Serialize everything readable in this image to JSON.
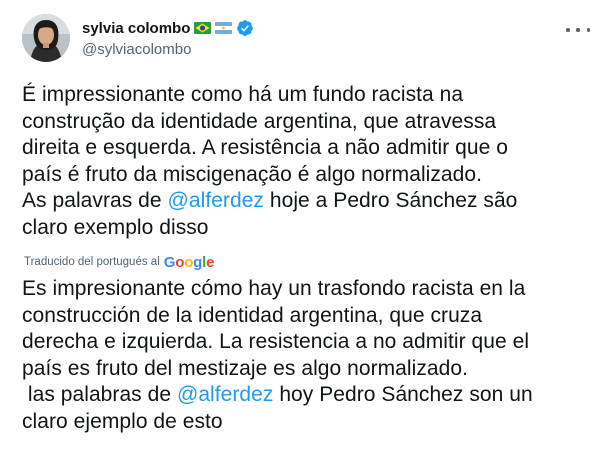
{
  "author": {
    "display_name": "sylvia colombo",
    "handle": "@sylviacolombo",
    "avatar_icon": "avatar-photo",
    "badges": [
      "brazil-flag-icon",
      "argentina-flag-icon",
      "verified-badge-icon"
    ]
  },
  "more_menu_icon": "more-horizontal-icon",
  "tweet": {
    "original_lines": [
      {
        "text": "É impressionante como há um fundo racista na"
      },
      {
        "text": "construção da identidade argentina, que atravessa"
      },
      {
        "text": "direita e esquerda. A resistência a não admitir que o"
      },
      {
        "text": "país é fruto da miscigenação é algo normalizado."
      },
      {
        "before": "As palavras de ",
        "mention": "@alferdez",
        "after": " hoje a Pedro Sánchez são"
      },
      {
        "text": "claro exemplo disso"
      }
    ],
    "translation_note": "Traducido del portugués al",
    "translation_provider": "Google",
    "translated_lines": [
      {
        "text": "Es impresionante cómo hay un trasfondo racista en la"
      },
      {
        "text": "construcción de la identidad argentina, que cruza"
      },
      {
        "text": "derecha e izquierda. La resistencia a no admitir que el"
      },
      {
        "text": "país es fruto del mestizaje es algo normalizado."
      },
      {
        "before": " las palabras de ",
        "mention": "@alferdez",
        "after": " hoy Pedro Sánchez son un"
      },
      {
        "text": "claro ejemplo de esto"
      }
    ]
  },
  "colors": {
    "text": "#0f1419",
    "secondary_text": "#536471",
    "link": "#1d9bf0",
    "verified": "#1d9bf0",
    "google_blue": "#4285f4",
    "google_red": "#ea4335",
    "google_yellow": "#fbbc05",
    "google_green": "#34a853"
  }
}
